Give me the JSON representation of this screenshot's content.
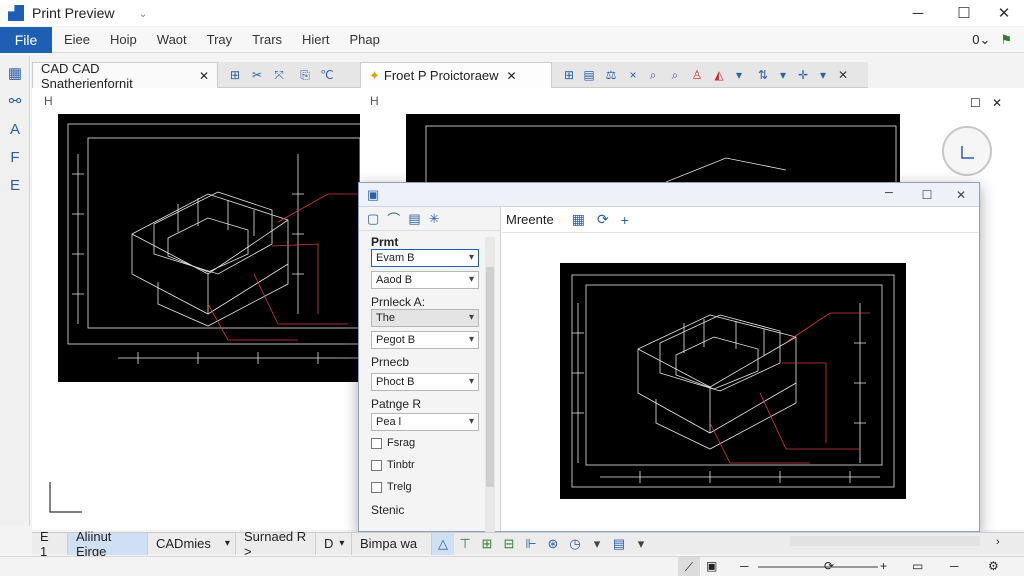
{
  "window": {
    "title": "Print Preview",
    "minimize": "─",
    "maximize": "☐",
    "close": "✕"
  },
  "menu": {
    "file": "File",
    "items": [
      "Eiee",
      "Hoip",
      "Waot",
      "Tray",
      "Trars",
      "Hiert",
      "Phap"
    ],
    "right": "0⌄"
  },
  "tabs": [
    {
      "label": "CAD CAD Snatherienfornit",
      "close": "✕"
    },
    {
      "label": "Froet P  Proictoraew",
      "close": "✕"
    }
  ],
  "left_tools": [
    "grid-icon",
    "link-icon",
    "triangle-icon",
    "f-icon",
    "e-icon"
  ],
  "panes": {
    "left_mark": "H",
    "right_mark": "H",
    "zoom_restore": "☐",
    "zoom_close": "✕"
  },
  "dialog": {
    "title_buttons": {
      "restore": "☐",
      "close": "✕"
    },
    "toolbar_label": "Mreente",
    "sections": [
      {
        "label": "Prmt"
      },
      {
        "label": "Prnleck  A:"
      },
      {
        "label": "Prnecb"
      },
      {
        "label": "Patnge  R"
      },
      {
        "label": "Stenic"
      }
    ],
    "combos": [
      "Evam B",
      "Aaod B",
      "The",
      "Pegot B",
      "Phoct B",
      "Pea l"
    ],
    "checkboxes": [
      "Fsrag",
      "Tinbtr",
      "Trelg"
    ]
  },
  "statusbar": {
    "items": [
      "E  1",
      "Aliinut Eirge",
      "CADmies",
      "Surnaed  R >",
      "D",
      "Bimpa wa"
    ]
  },
  "colors": {
    "accent": "#1e5fb4",
    "cad_bg": "#000000",
    "cad_line": "#e8e8e8",
    "dim_red": "#d63a3a"
  }
}
